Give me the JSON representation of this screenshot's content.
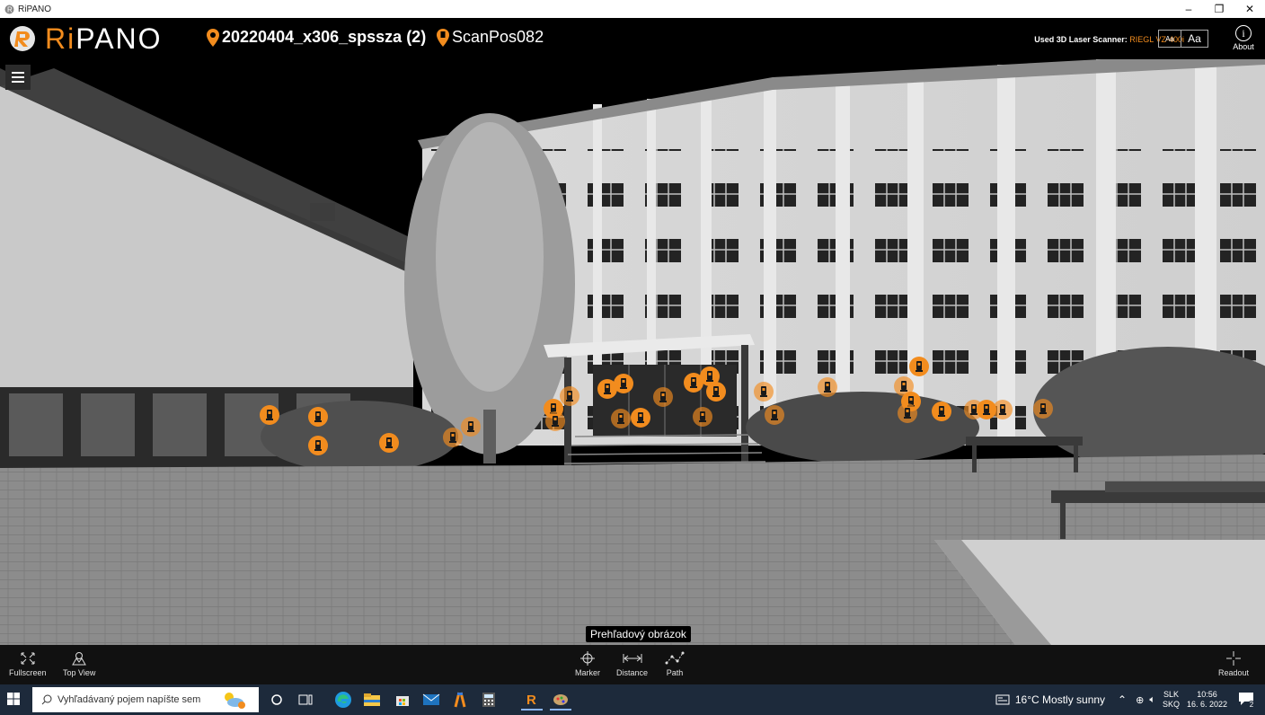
{
  "window": {
    "title": "RiPANO",
    "controls": {
      "minimize": "–",
      "maximize": "❐",
      "close": "✕"
    }
  },
  "header": {
    "logo_prefix": "Ri",
    "logo_suffix": "PANO",
    "project": "20220404_x306_spssza (2)",
    "scan_position": "ScanPos082",
    "scanner_label": "Used 3D Laser Scanner:",
    "scanner_model": "RIEGL VZ-400i",
    "font_small": "Aa",
    "font_large": "Aa",
    "about_icon": "i",
    "about_label": "About"
  },
  "viewport": {
    "tooltip": "Prehľadový obrázok",
    "marker_icon": "scanner-position-icon",
    "accent": "#f28c1e"
  },
  "toolbar": {
    "fullscreen": "Fullscreen",
    "top_view": "Top View",
    "marker": "Marker",
    "distance": "Distance",
    "path": "Path",
    "readout": "Readout"
  },
  "taskbar": {
    "search_placeholder": "Vyhľadávaný pojem napíšte sem",
    "weather": "16°C  Mostly sunny",
    "lang_top": "SLK",
    "lang_bottom": "SKQ",
    "time": "10:56",
    "date": "16. 6. 2022",
    "notifications": "2"
  }
}
